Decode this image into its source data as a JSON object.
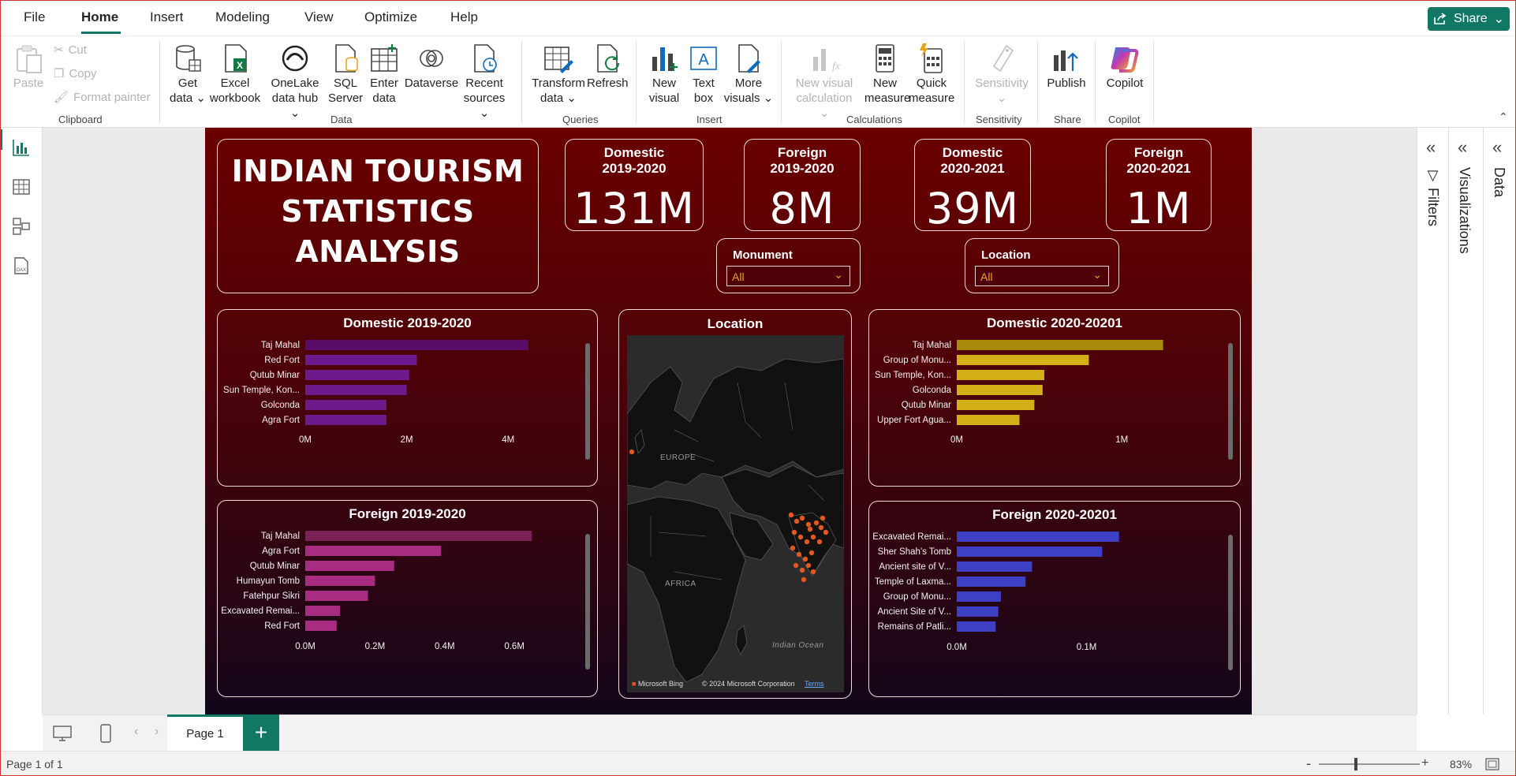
{
  "menu": {
    "tabs": [
      "File",
      "Home",
      "Insert",
      "Modeling",
      "View",
      "Optimize",
      "Help"
    ],
    "active": "Home",
    "share_label": "Share"
  },
  "ribbon": {
    "clipboard": {
      "paste": "Paste",
      "cut": "Cut",
      "copy": "Copy",
      "format_painter": "Format painter",
      "group": "Clipboard"
    },
    "data": {
      "get_data": [
        "Get",
        "data"
      ],
      "excel": [
        "Excel",
        "workbook"
      ],
      "onelake": [
        "OneLake",
        "data hub"
      ],
      "sql": [
        "SQL",
        "Server"
      ],
      "enter": [
        "Enter",
        "data"
      ],
      "dataverse": "Dataverse",
      "recent": [
        "Recent",
        "sources"
      ],
      "group": "Data"
    },
    "queries": {
      "transform": [
        "Transform",
        "data"
      ],
      "refresh": "Refresh",
      "group": "Queries"
    },
    "insert": {
      "new_visual": [
        "New",
        "visual"
      ],
      "text_box": [
        "Text",
        "box"
      ],
      "more_visuals": [
        "More",
        "visuals"
      ],
      "group": "Insert"
    },
    "calculations": {
      "new_visual_calc": [
        "New visual",
        "calculation"
      ],
      "new_measure": [
        "New",
        "measure"
      ],
      "quick_measure": [
        "Quick",
        "measure"
      ],
      "group": "Calculations"
    },
    "sensitivity": {
      "label": "Sensitivity",
      "group": "Sensitivity"
    },
    "share": {
      "publish": "Publish",
      "group": "Share"
    },
    "copilot": {
      "label": "Copilot",
      "group": "Copilot"
    }
  },
  "report": {
    "title": [
      "INDIAN TOURISM",
      "STATISTICS",
      "ANALYSIS"
    ],
    "kpis": [
      {
        "label": [
          "Domestic",
          "2019-2020"
        ],
        "value": "131M"
      },
      {
        "label": [
          "Foreign",
          "2019-2020"
        ],
        "value": "8M"
      },
      {
        "label": [
          "Domestic",
          "2020-2021"
        ],
        "value": "39M"
      },
      {
        "label": [
          "Foreign",
          "2020-2021"
        ],
        "value": "1M"
      }
    ],
    "slicers": [
      {
        "label": "Monument",
        "value": "All"
      },
      {
        "label": "Location",
        "value": "All"
      }
    ],
    "map": {
      "title": "Location",
      "regions": [
        "EUROPE",
        "AFRICA",
        "Indian Ocean"
      ],
      "credit": "Microsoft Bing",
      "copyright": "© 2024 Microsoft Corporation",
      "terms": "Terms",
      "point_color": "#e2581f"
    }
  },
  "chart_data": [
    {
      "id": "dom1920",
      "type": "bar",
      "title": "Domestic 2019-2020",
      "orientation": "horizontal",
      "categories": [
        "Taj Mahal",
        "Red Fort",
        "Qutub Minar",
        "Sun Temple, Kon...",
        "Golconda",
        "Agra Fort"
      ],
      "values": [
        4.4,
        2.2,
        2.05,
        2.0,
        1.6,
        1.6
      ],
      "xticks": [
        0,
        2,
        4
      ],
      "xtick_labels": [
        "0M",
        "2M",
        "4M"
      ],
      "xlim": [
        0,
        5.1
      ],
      "color": "#6d1a8c",
      "top_color": "#5a0c6b"
    },
    {
      "id": "dom2021",
      "type": "bar",
      "title": "Domestic 2020-20201",
      "orientation": "horizontal",
      "categories": [
        "Taj Mahal",
        "Group of Monu...",
        "Sun Temple, Kon...",
        "Golconda",
        "Qutub Minar",
        "Upper Fort Agua..."
      ],
      "values": [
        1.25,
        0.8,
        0.53,
        0.52,
        0.47,
        0.38
      ],
      "xticks": [
        0,
        1
      ],
      "xtick_labels": [
        "0M",
        "1M"
      ],
      "xlim": [
        0,
        1.51
      ],
      "color": "#d4b018",
      "top_color": "#a88b0a"
    },
    {
      "id": "for1920",
      "type": "bar",
      "title": "Foreign 2019-2020",
      "orientation": "horizontal",
      "categories": [
        "Taj Mahal",
        "Agra Fort",
        "Qutub Minar",
        "Humayun Tomb",
        "Fatehpur Sikri",
        "Excavated Remai...",
        "Red Fort"
      ],
      "values": [
        0.65,
        0.39,
        0.255,
        0.2,
        0.18,
        0.1,
        0.09
      ],
      "xticks": [
        0,
        0.2,
        0.4,
        0.6
      ],
      "xtick_labels": [
        "0.0M",
        "0.2M",
        "0.4M",
        "0.6M"
      ],
      "xlim": [
        0,
        0.74
      ],
      "color": "#a82c82",
      "top_color": "#7a2158"
    },
    {
      "id": "for2021",
      "type": "bar",
      "title": "Foreign 2020-20201",
      "orientation": "horizontal",
      "categories": [
        "Excavated Remai...",
        "Sher Shah's Tomb",
        "Ancient site of V...",
        "Temple of Laxma...",
        "Group of Monu...",
        "Ancient Site of V...",
        "Remains of Patli..."
      ],
      "values": [
        0.125,
        0.112,
        0.058,
        0.053,
        0.034,
        0.032,
        0.03
      ],
      "xticks": [
        0,
        0.1
      ],
      "xtick_labels": [
        "0.0M",
        "0.1M"
      ],
      "xlim": [
        0,
        0.192
      ],
      "color": "#3d3fc4",
      "top_color": "#3d3fc4"
    }
  ],
  "page_tabs": {
    "current": "Page 1",
    "add": "+"
  },
  "panes": {
    "filters": "Filters",
    "visualizations": "Visualizations",
    "data": "Data"
  },
  "status": {
    "page_info": "Page 1 of 1",
    "zoom": "83%"
  }
}
